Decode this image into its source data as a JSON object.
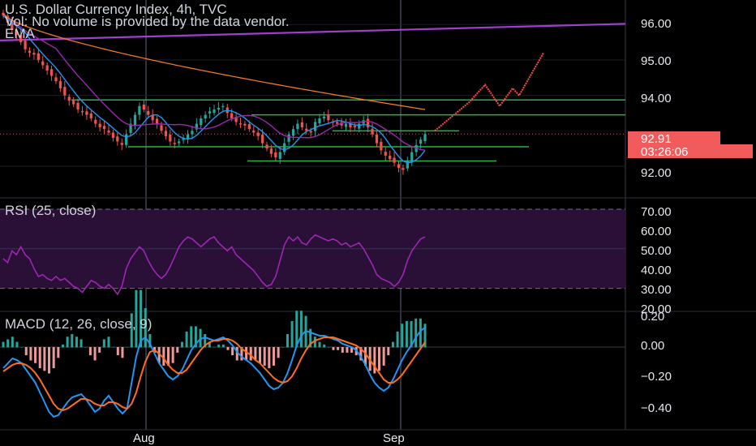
{
  "header": {
    "title": "U.S. Dollar Currency Index, 4h, TVC",
    "volume_note": "Vol: No volume is provided by the data vendor.",
    "ema_label": "EMA"
  },
  "price_panel": {
    "last_price": "92.91",
    "countdown": "03:26:06",
    "ticks": [
      "96.00",
      "95.00",
      "94.00",
      "92.00"
    ]
  },
  "rsi_panel": {
    "label": "RSI (25, close)",
    "ticks": [
      "70.00",
      "60.00",
      "50.00",
      "40.00",
      "30.00",
      "20.00"
    ]
  },
  "macd_panel": {
    "label": "MACD (12, 26, close, 9)",
    "ticks": [
      "0.20",
      "0.00",
      "−0.20",
      "−0.40"
    ]
  },
  "x_axis": {
    "labels": [
      "Aug",
      "Sep"
    ]
  },
  "colors": {
    "bull": "#26a69a",
    "bear": "#ef5350",
    "ma_fast": "#2196f3",
    "ma_mid": "#9c27b0",
    "ma_slow": "#ff7f27",
    "ma_long": "#a23ecf",
    "level": "#29b340",
    "projection": "#ff4a4a",
    "rsi": "#9c27b0",
    "rsi_band": "#2a0f37",
    "macd": "#2196f3",
    "signal": "#ff6d1f"
  },
  "chart_data": [
    {
      "type": "candlestick",
      "title": "U.S. Dollar Currency Index, 4h, TVC",
      "ylim": [
        91.2,
        96.6
      ],
      "y_ticks": [
        92,
        94,
        95,
        96
      ],
      "candle_closes": [
        96.25,
        96.05,
        95.85,
        95.7,
        95.5,
        95.3,
        95.2,
        95.15,
        95.0,
        94.85,
        94.7,
        94.55,
        94.4,
        94.2,
        94.0,
        93.85,
        93.75,
        93.6,
        93.55,
        93.45,
        93.35,
        93.2,
        93.1,
        93.05,
        92.95,
        92.8,
        92.7,
        92.6,
        92.9,
        93.2,
        93.45,
        93.7,
        93.6,
        93.45,
        93.3,
        93.2,
        93.0,
        92.85,
        92.7,
        92.65,
        92.7,
        92.8,
        92.9,
        93.0,
        93.2,
        93.35,
        93.45,
        93.55,
        93.6,
        93.65,
        93.7,
        93.5,
        93.35,
        93.25,
        93.2,
        93.15,
        93.05,
        92.95,
        92.85,
        92.65,
        92.5,
        92.35,
        92.25,
        92.4,
        92.65,
        92.9,
        93.05,
        93.2,
        93.1,
        93.0,
        92.95,
        93.25,
        93.35,
        93.4,
        93.3,
        93.25,
        93.2,
        93.15,
        93.2,
        93.1,
        93.1,
        93.2,
        93.3,
        93.1,
        92.9,
        92.65,
        92.45,
        92.3,
        92.2,
        92.1,
        91.95,
        91.9,
        92.15,
        92.4,
        92.6,
        92.75,
        92.91
      ],
      "horizontal_levels": [
        93.87,
        93.45,
        93.0,
        92.55,
        92.15
      ],
      "projection_path": [
        93.0,
        93.8,
        94.3,
        93.7,
        94.2,
        94.0,
        95.2
      ],
      "last_price": 92.91
    },
    {
      "type": "line",
      "title": "RSI (25, close)",
      "ylim": [
        20,
        70
      ],
      "band": [
        30,
        70
      ],
      "y_ticks": [
        70,
        60,
        50,
        40,
        30,
        20
      ],
      "values": [
        45,
        43,
        49,
        47,
        51,
        47,
        45,
        40,
        36,
        37,
        35,
        34,
        36,
        34,
        35,
        33,
        31,
        30,
        28,
        31,
        34,
        33,
        31,
        30,
        32,
        30,
        27,
        31,
        40,
        45,
        48,
        51,
        49,
        44,
        40,
        37,
        35,
        37,
        41,
        46,
        51,
        54,
        56,
        55,
        53,
        51,
        53,
        55,
        56,
        53,
        51,
        49,
        51,
        47,
        45,
        43,
        41,
        39,
        36,
        33,
        31,
        32,
        36,
        44,
        52,
        56,
        54,
        56,
        53,
        52,
        55,
        57,
        56,
        55,
        54,
        55,
        54,
        52,
        53,
        51,
        52,
        53,
        50,
        46,
        42,
        37,
        35,
        34,
        33,
        31,
        33,
        37,
        44,
        49,
        52,
        55,
        56
      ]
    },
    {
      "type": "line",
      "title": "MACD (12, 26, close, 9)",
      "ylim": [
        -0.5,
        0.2
      ],
      "y_ticks": [
        0.2,
        0,
        -0.2,
        -0.4
      ],
      "series": [
        {
          "name": "MACD",
          "values": [
            -0.13,
            -0.1,
            -0.07,
            -0.08,
            -0.1,
            -0.14,
            -0.18,
            -0.22,
            -0.28,
            -0.34,
            -0.4,
            -0.43,
            -0.42,
            -0.38,
            -0.34,
            -0.31,
            -0.3,
            -0.29,
            -0.32,
            -0.36,
            -0.4,
            -0.38,
            -0.33,
            -0.3,
            -0.34,
            -0.38,
            -0.41,
            -0.38,
            -0.22,
            -0.06,
            0.04,
            0.06,
            0.02,
            -0.04,
            -0.1,
            -0.14,
            -0.18,
            -0.2,
            -0.18,
            -0.14,
            -0.08,
            -0.02,
            0.02,
            0.05,
            0.06,
            0.05,
            0.04,
            0.05,
            0.06,
            0.04,
            0.01,
            -0.03,
            -0.06,
            -0.08,
            -0.1,
            -0.13,
            -0.16,
            -0.2,
            -0.24,
            -0.26,
            -0.25,
            -0.22,
            -0.16,
            -0.08,
            0.01,
            0.07,
            0.1,
            0.09,
            0.08,
            0.07,
            0.07,
            0.06,
            0.05,
            0.04,
            0.02,
            0.01,
            0.0,
            -0.02,
            -0.06,
            -0.11,
            -0.17,
            -0.22,
            -0.25,
            -0.27,
            -0.25,
            -0.2,
            -0.14,
            -0.08,
            -0.03,
            0.01,
            0.06,
            0.1,
            0.12
          ]
        },
        {
          "name": "Signal",
          "values": [
            -0.15,
            -0.13,
            -0.11,
            -0.1,
            -0.1,
            -0.11,
            -0.13,
            -0.16,
            -0.2,
            -0.25,
            -0.3,
            -0.35,
            -0.38,
            -0.39,
            -0.38,
            -0.36,
            -0.34,
            -0.32,
            -0.32,
            -0.33,
            -0.35,
            -0.36,
            -0.36,
            -0.34,
            -0.34,
            -0.35,
            -0.37,
            -0.38,
            -0.35,
            -0.28,
            -0.18,
            -0.09,
            -0.03,
            -0.02,
            -0.04,
            -0.07,
            -0.11,
            -0.14,
            -0.16,
            -0.16,
            -0.14,
            -0.1,
            -0.06,
            -0.02,
            0.01,
            0.03,
            0.04,
            0.04,
            0.05,
            0.05,
            0.04,
            0.02,
            -0.01,
            -0.03,
            -0.05,
            -0.08,
            -0.1,
            -0.13,
            -0.16,
            -0.19,
            -0.21,
            -0.22,
            -0.21,
            -0.18,
            -0.13,
            -0.07,
            -0.02,
            0.02,
            0.04,
            0.05,
            0.06,
            0.06,
            0.06,
            0.05,
            0.04,
            0.03,
            0.02,
            0.01,
            -0.01,
            -0.04,
            -0.08,
            -0.12,
            -0.16,
            -0.2,
            -0.22,
            -0.22,
            -0.2,
            -0.17,
            -0.13,
            -0.09,
            -0.05,
            -0.01,
            0.03
          ]
        }
      ]
    }
  ]
}
